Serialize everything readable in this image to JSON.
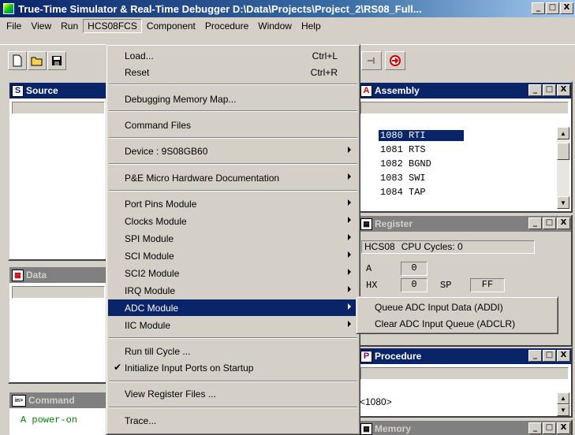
{
  "window": {
    "title": "True-Time Simulator & Real-Time Debugger  D:\\Data\\Projects\\Project_2\\RS08_Full...",
    "min": "_",
    "max": "□",
    "close": "X"
  },
  "menubar": [
    "File",
    "View",
    "Run",
    "HCS08FCS",
    "Component",
    "Procedure",
    "Window",
    "Help"
  ],
  "source": {
    "title": "Source"
  },
  "data": {
    "title": "Data"
  },
  "command": {
    "title": "Command",
    "line": "A power-on"
  },
  "assembly": {
    "title": "Assembly",
    "lines": [
      "1080 RTI",
      "1081 RTS",
      "1082 BGND",
      "1083 SWI",
      "1084 TAP"
    ]
  },
  "register": {
    "title": "Register",
    "cpu": "HCS08",
    "cycles": "CPU Cycles: 0",
    "a_label": "A",
    "a_value": "0",
    "hx_label": "HX",
    "hx_value": "0",
    "sp_label": "SP",
    "sp_value": "FF"
  },
  "procedure": {
    "title": "Procedure",
    "entry": "<1080>"
  },
  "memory": {
    "title": "Memory"
  },
  "hcs08_menu": {
    "load": "Load...",
    "load_sc": "Ctrl+L",
    "reset": "Reset",
    "reset_sc": "Ctrl+R",
    "memory_map": "Debugging Memory Map...",
    "command_files": "Command Files",
    "device": "Device : 9S08GB60",
    "pe_docs": "P&E Micro Hardware Documentation",
    "port_pins": "Port Pins Module",
    "clocks": "Clocks Module",
    "spi": "SPI Module",
    "sci": "SCI Module",
    "sci2": "SCI2 Module",
    "irq": "IRQ Module",
    "adc": "ADC Module",
    "iic": "IIC Module",
    "run_till": "Run till Cycle ...",
    "init_ports": "Initialize Input Ports on Startup",
    "check_mark": "✔",
    "view_regs": "View Register Files ...",
    "trace": "Trace..."
  },
  "adc_submenu": {
    "queue": "Queue ADC Input Data (ADDI)",
    "clear": "Clear ADC Input Queue (ADCLR)"
  }
}
